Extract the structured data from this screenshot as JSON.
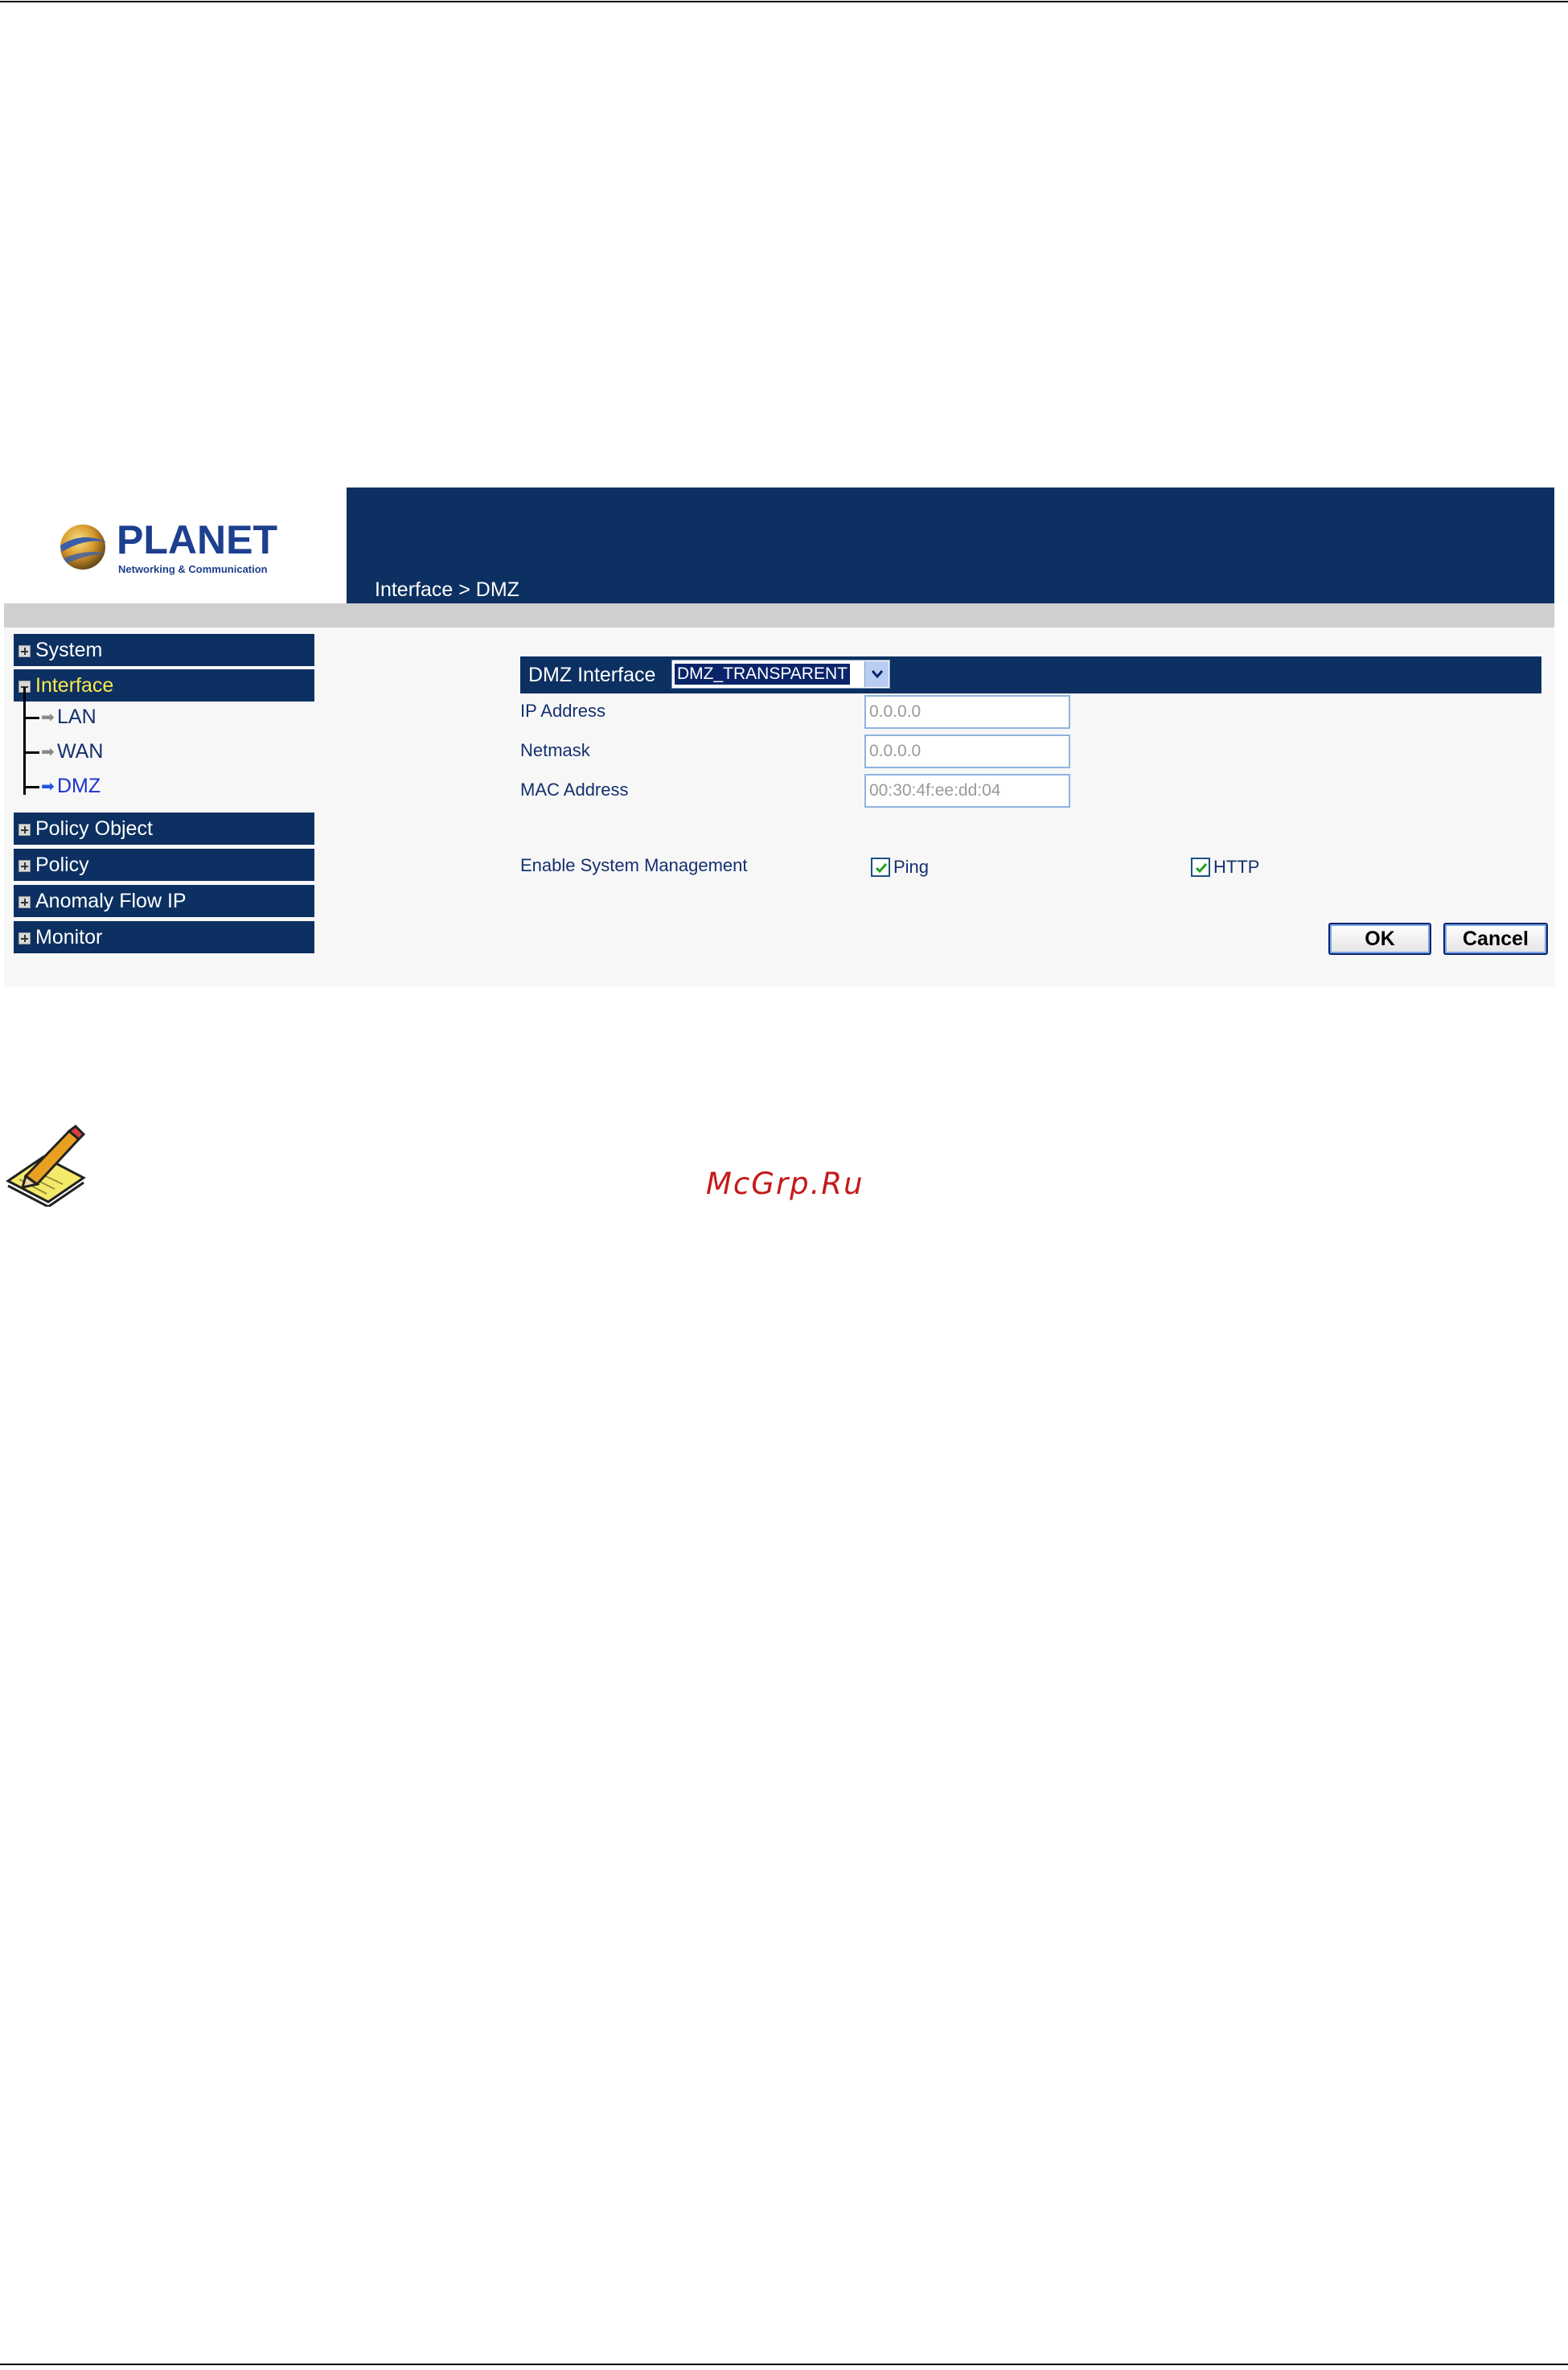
{
  "logo": {
    "brand": "PLANET",
    "tagline": "Networking & Communication"
  },
  "header": {
    "breadcrumb": "Interface > DMZ"
  },
  "sidebar": {
    "items": [
      {
        "label": "System"
      },
      {
        "label": "Interface"
      },
      {
        "label": "Policy Object"
      },
      {
        "label": "Policy"
      },
      {
        "label": "Anomaly Flow IP"
      },
      {
        "label": "Monitor"
      }
    ],
    "interface_sub": [
      {
        "label": "LAN"
      },
      {
        "label": "WAN"
      },
      {
        "label": "DMZ"
      }
    ]
  },
  "form": {
    "dmz_interface_label": "DMZ Interface",
    "dmz_interface_value": "DMZ_TRANSPARENT",
    "ip_address_label": "IP Address",
    "ip_address_value": "0.0.0.0",
    "netmask_label": "Netmask",
    "netmask_value": "0.0.0.0",
    "mac_address_label": "MAC Address",
    "mac_address_value": "00:30:4f:ee:dd:04",
    "system_management_label": "Enable System Management",
    "ping_label": "Ping",
    "ping_checked": true,
    "http_label": "HTTP",
    "http_checked": true,
    "ok_label": "OK",
    "cancel_label": "Cancel"
  },
  "colors": {
    "nav_bg": "#0c3061",
    "active_nav_text": "#ffe84f",
    "label_text": "#14306e",
    "watermark": "#c41a1a"
  },
  "icons": {
    "note": "note-pencil-icon",
    "expand": "plus-icon",
    "collapse": "minus-icon",
    "sub_item": "arrow-right-icon"
  },
  "watermark": "McGrp.Ru"
}
